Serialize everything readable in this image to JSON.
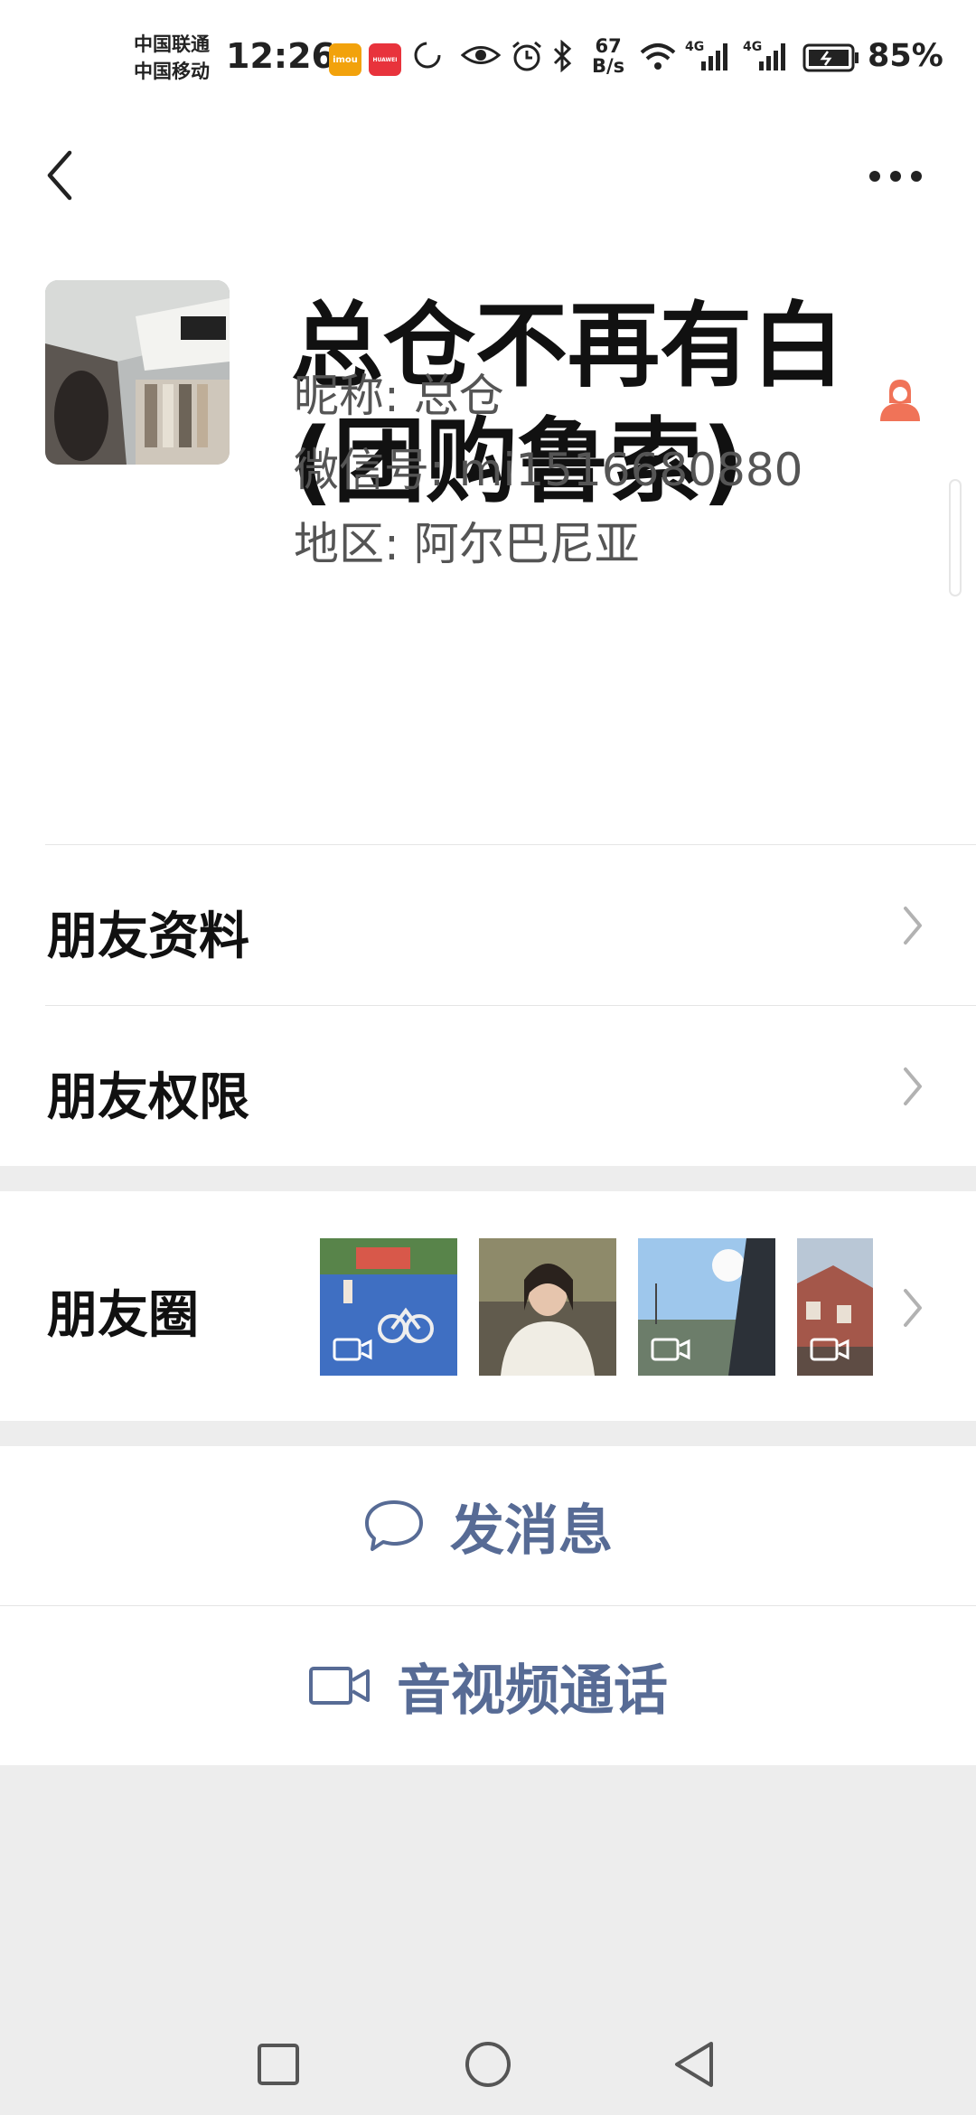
{
  "status_bar": {
    "carrier_1": "中国联通",
    "carrier_2": "中国移动",
    "time": "12:26",
    "app_badge_1": "imou",
    "app_badge_2": "HUAWEI",
    "net_speed_value": "67",
    "net_speed_unit": "B/s",
    "signal_1": "4G",
    "signal_2": "4G",
    "battery": "85%"
  },
  "header": {
    "back_icon": "chevron-left-icon",
    "more_icon": "more-dots-icon"
  },
  "profile": {
    "display_name": "总仓不再有白(团购鲁索)",
    "nickname_label": "昵称:",
    "nickname": "总仓",
    "wechat_id_label": "微信号:",
    "wechat_id": "mi1516680880",
    "region_label": "地区:",
    "region": "阿尔巴尼亚",
    "gender_icon": "female-icon"
  },
  "rows": {
    "friend_profile": "朋友资料",
    "friend_permissions": "朋友权限",
    "moments": "朋友圈"
  },
  "actions": {
    "send_message": "发消息",
    "video_call": "音视频通话"
  },
  "colors": {
    "link_blue": "#576b95",
    "female_icon": "#f07358",
    "background": "#ededed"
  }
}
